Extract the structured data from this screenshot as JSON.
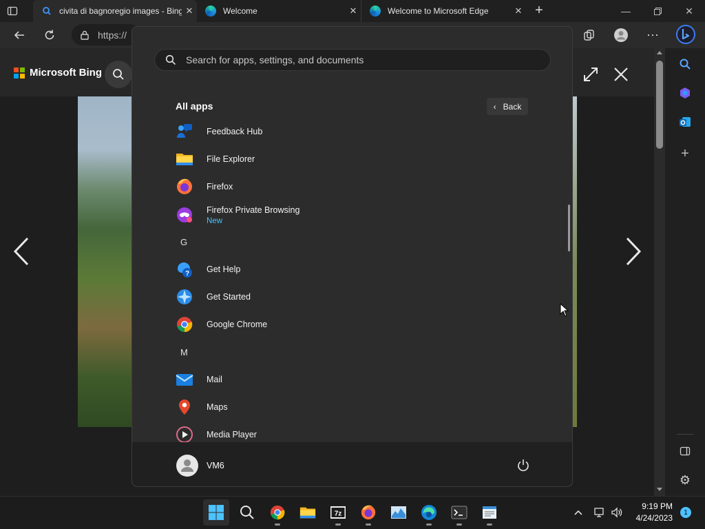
{
  "browser": {
    "tabs": [
      {
        "title": "civita di bagnoregio images - Bing",
        "active": true
      },
      {
        "title": "Welcome",
        "active": false
      },
      {
        "title": "Welcome to Microsoft Edge",
        "active": false
      }
    ],
    "address": "https://",
    "new_tab_symbol": "+"
  },
  "bing": {
    "brand": "Microsoft Bing"
  },
  "start_menu": {
    "search_placeholder": "Search for apps, settings, and documents",
    "section_title": "All apps",
    "back_label": "Back",
    "apps": [
      {
        "label": "Feedback Hub",
        "icon": "feedback-hub-icon"
      },
      {
        "label": "File Explorer",
        "icon": "file-explorer-icon"
      },
      {
        "label": "Firefox",
        "icon": "firefox-icon"
      },
      {
        "label": "Firefox Private Browsing",
        "sub": "New",
        "icon": "firefox-private-icon"
      },
      {
        "label": "Get Help",
        "icon": "get-help-icon"
      },
      {
        "label": "Get Started",
        "icon": "get-started-icon"
      },
      {
        "label": "Google Chrome",
        "icon": "chrome-icon"
      },
      {
        "label": "Mail",
        "icon": "mail-icon"
      },
      {
        "label": "Maps",
        "icon": "maps-icon"
      },
      {
        "label": "Media Player",
        "icon": "media-player-icon"
      }
    ],
    "letters": [
      "G",
      "M"
    ],
    "user": "VM6"
  },
  "taskbar": {
    "time": "9:19 PM",
    "date": "4/24/2023",
    "notification_count": "1",
    "apps": [
      "start",
      "search",
      "chrome",
      "file-explorer",
      "7zip",
      "firefox",
      "task-manager",
      "edge",
      "terminal",
      "notepad"
    ]
  },
  "colors": {
    "accent": "#4cc2ff",
    "menu_bg": "#2c2c2c",
    "taskbar_bg": "#1c1c1c"
  }
}
